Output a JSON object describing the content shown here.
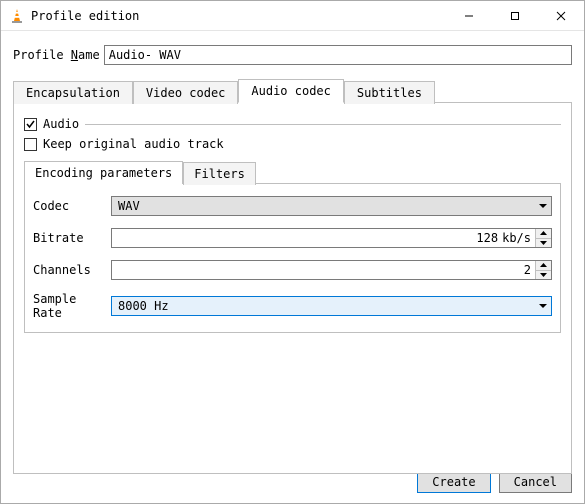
{
  "window": {
    "title": "Profile edition"
  },
  "profile": {
    "name_label_pre": "Profile ",
    "name_label_u": "N",
    "name_label_post": "ame",
    "name_value": "Audio- WAV"
  },
  "tabs_main": {
    "encapsulation": "Encapsulation",
    "video_codec": "Video codec",
    "audio_codec": "Audio codec",
    "subtitles": "Subtitles"
  },
  "audio_panel": {
    "audio_label": "Audio",
    "keep_label": "Keep original audio track",
    "audio_checked": true,
    "keep_checked": false
  },
  "tabs_inner": {
    "encoding": "Encoding parameters",
    "filters": "Filters"
  },
  "fields": {
    "codec_label": "Codec",
    "codec_value": "WAV",
    "bitrate_label": "Bitrate",
    "bitrate_value": "128",
    "bitrate_unit": "kb/s",
    "channels_label": "Channels",
    "channels_value": "2",
    "samplerate_label": "Sample Rate",
    "samplerate_value": "8000 Hz"
  },
  "buttons": {
    "create": "Create",
    "cancel": "Cancel"
  }
}
